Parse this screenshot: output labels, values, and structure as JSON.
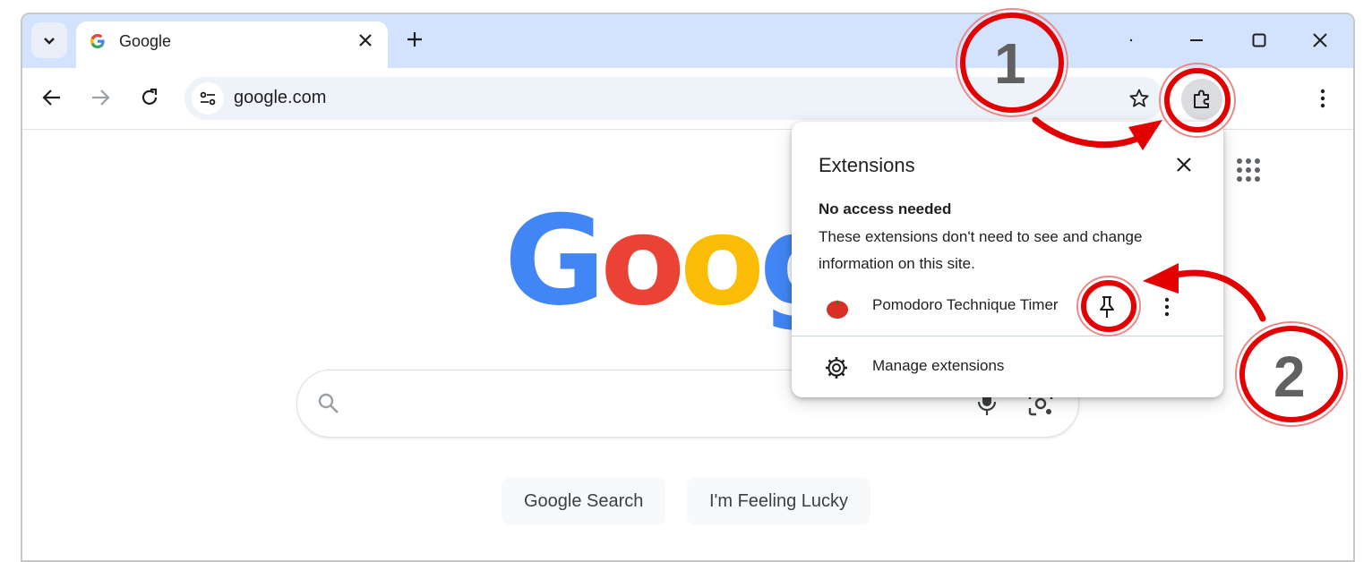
{
  "tab": {
    "title": "Google"
  },
  "toolbar": {
    "url": "google.com"
  },
  "search": {
    "buttons": [
      "Google Search",
      "I'm Feeling Lucky"
    ]
  },
  "logo": {
    "letters": [
      "G",
      "o",
      "o",
      "g"
    ],
    "colors": [
      "#4285F4",
      "#EA4335",
      "#FBBC05",
      "#4285F4"
    ]
  },
  "popup": {
    "title": "Extensions",
    "section_heading": "No access needed",
    "description": "These extensions don't need to see and change information on this site.",
    "extension_name": "Pomodoro Technique Timer",
    "manage_label": "Manage extensions"
  },
  "annotations": {
    "step1": "1",
    "step2": "2",
    "color": "#e30000"
  }
}
